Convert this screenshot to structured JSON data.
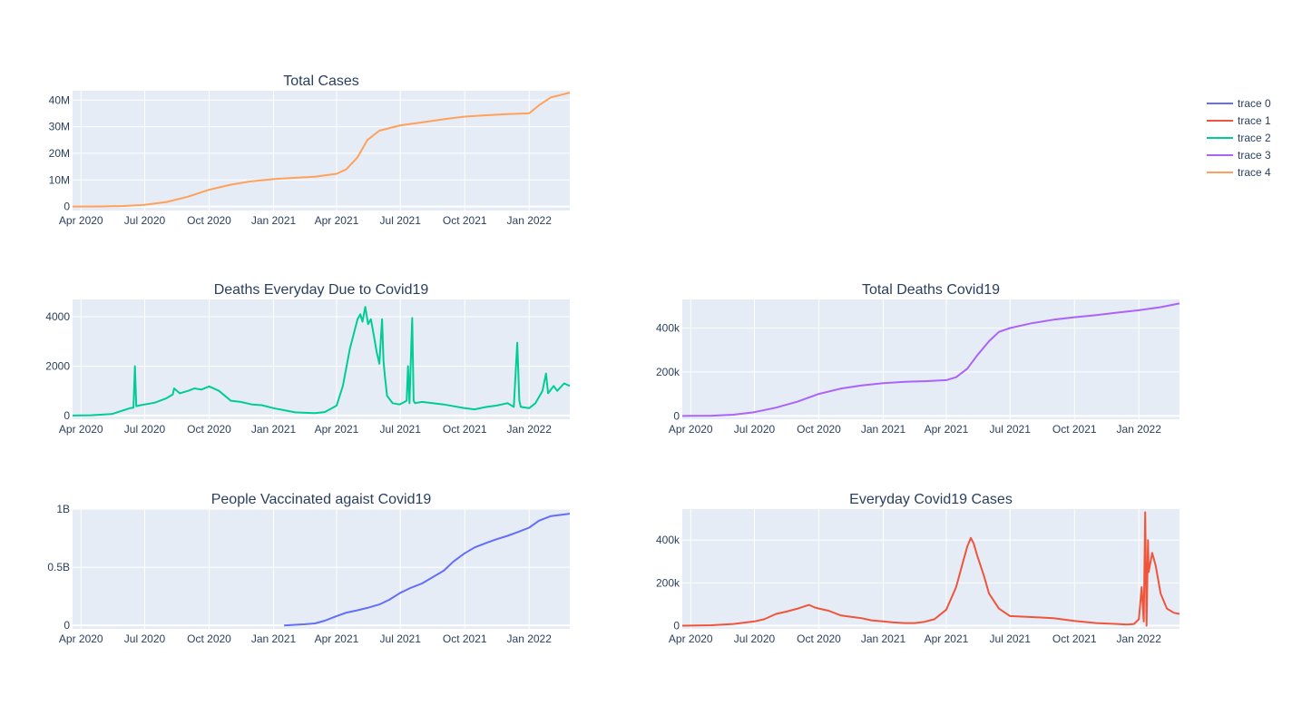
{
  "chart_data": [
    {
      "id": "total-cases",
      "type": "line",
      "title": "Total Cases",
      "trace": 4,
      "x_ticks": [
        "Apr 2020",
        "Jul 2020",
        "Oct 2020",
        "Jan 2021",
        "Apr 2021",
        "Jul 2021",
        "Oct 2021",
        "Jan 2022"
      ],
      "xlim": [
        "2020-03-20",
        "2022-02-28"
      ],
      "ylim": [
        -1500000,
        43500000
      ],
      "y_ticks": [
        {
          "v": 0,
          "label": "0"
        },
        {
          "v": 10000000,
          "label": "10M"
        },
        {
          "v": 20000000,
          "label": "20M"
        },
        {
          "v": 30000000,
          "label": "30M"
        },
        {
          "v": 40000000,
          "label": "40M"
        }
      ],
      "x": [
        "2020-03-20",
        "2020-05-01",
        "2020-06-01",
        "2020-07-01",
        "2020-08-01",
        "2020-09-01",
        "2020-10-01",
        "2020-11-01",
        "2020-12-01",
        "2021-01-01",
        "2021-02-01",
        "2021-03-01",
        "2021-04-01",
        "2021-04-15",
        "2021-05-01",
        "2021-05-15",
        "2021-06-01",
        "2021-07-01",
        "2021-08-01",
        "2021-09-01",
        "2021-10-01",
        "2021-11-01",
        "2021-12-01",
        "2022-01-01",
        "2022-01-15",
        "2022-02-01",
        "2022-02-28"
      ],
      "y": [
        0,
        35000,
        190000,
        600000,
        1700000,
        3700000,
        6300000,
        8200000,
        9500000,
        10300000,
        10800000,
        11200000,
        12300000,
        14000000,
        18500000,
        25000000,
        28500000,
        30500000,
        31600000,
        32800000,
        33800000,
        34300000,
        34700000,
        35000000,
        38000000,
        41000000,
        42800000
      ],
      "series": [
        {
          "name": "trace 4",
          "color": "#FFA15A"
        }
      ]
    },
    {
      "id": "deaths-everyday",
      "type": "line",
      "title": "Deaths Everyday Due to Covid19",
      "trace": 2,
      "x_ticks": [
        "Apr 2020",
        "Jul 2020",
        "Oct 2020",
        "Jan 2021",
        "Apr 2021",
        "Jul 2021",
        "Oct 2021",
        "Jan 2022"
      ],
      "xlim": [
        "2020-03-20",
        "2022-02-28"
      ],
      "ylim": [
        -150,
        4700
      ],
      "y_ticks": [
        {
          "v": 0,
          "label": "0"
        },
        {
          "v": 2000,
          "label": "2000"
        },
        {
          "v": 4000,
          "label": "4000"
        }
      ],
      "x": [
        "2020-03-20",
        "2020-04-15",
        "2020-05-15",
        "2020-06-10",
        "2020-06-15",
        "2020-06-17",
        "2020-06-19",
        "2020-06-25",
        "2020-07-15",
        "2020-08-01",
        "2020-08-10",
        "2020-08-12",
        "2020-08-20",
        "2020-09-01",
        "2020-09-10",
        "2020-09-20",
        "2020-10-01",
        "2020-10-15",
        "2020-11-01",
        "2020-11-15",
        "2020-12-01",
        "2020-12-15",
        "2021-01-01",
        "2021-01-15",
        "2021-02-01",
        "2021-02-15",
        "2021-03-01",
        "2021-03-15",
        "2021-04-01",
        "2021-04-10",
        "2021-04-20",
        "2021-05-01",
        "2021-05-05",
        "2021-05-08",
        "2021-05-12",
        "2021-05-16",
        "2021-05-20",
        "2021-05-25",
        "2021-05-28",
        "2021-06-01",
        "2021-06-05",
        "2021-06-07",
        "2021-06-09",
        "2021-06-12",
        "2021-06-20",
        "2021-06-30",
        "2021-07-10",
        "2021-07-12",
        "2021-07-14",
        "2021-07-18",
        "2021-07-20",
        "2021-07-22",
        "2021-08-01",
        "2021-09-01",
        "2021-10-01",
        "2021-10-15",
        "2021-11-01",
        "2021-11-15",
        "2021-12-01",
        "2021-12-10",
        "2021-12-15",
        "2021-12-18",
        "2021-12-20",
        "2022-01-01",
        "2022-01-10",
        "2022-01-20",
        "2022-01-25",
        "2022-01-28",
        "2022-02-05",
        "2022-02-10",
        "2022-02-20",
        "2022-02-28"
      ],
      "y": [
        0,
        10,
        60,
        300,
        320,
        2000,
        380,
        420,
        520,
        700,
        850,
        1100,
        900,
        1000,
        1100,
        1050,
        1180,
        1000,
        600,
        550,
        450,
        420,
        300,
        220,
        130,
        110,
        100,
        140,
        400,
        1200,
        2700,
        3900,
        4100,
        3800,
        4400,
        3700,
        3900,
        3100,
        2600,
        2100,
        3900,
        2200,
        1600,
        800,
        500,
        450,
        600,
        2000,
        500,
        3950,
        600,
        500,
        550,
        450,
        300,
        250,
        350,
        400,
        500,
        350,
        2950,
        600,
        350,
        300,
        500,
        1000,
        1700,
        900,
        1200,
        1000,
        1300,
        1200
      ],
      "series": [
        {
          "name": "trace 2",
          "color": "#00CC96"
        }
      ]
    },
    {
      "id": "total-deaths",
      "type": "line",
      "title": "Total Deaths Covid19",
      "trace": 3,
      "x_ticks": [
        "Apr 2020",
        "Jul 2020",
        "Oct 2020",
        "Jan 2021",
        "Apr 2021",
        "Jul 2021",
        "Oct 2021",
        "Jan 2022"
      ],
      "xlim": [
        "2020-03-20",
        "2022-02-28"
      ],
      "ylim": [
        -15000,
        530000
      ],
      "y_ticks": [
        {
          "v": 0,
          "label": "0"
        },
        {
          "v": 200000,
          "label": "200k"
        },
        {
          "v": 400000,
          "label": "400k"
        }
      ],
      "x": [
        "2020-03-20",
        "2020-05-01",
        "2020-06-01",
        "2020-07-01",
        "2020-08-01",
        "2020-09-01",
        "2020-10-01",
        "2020-11-01",
        "2020-12-01",
        "2021-01-01",
        "2021-02-01",
        "2021-03-01",
        "2021-04-01",
        "2021-04-15",
        "2021-05-01",
        "2021-05-15",
        "2021-06-01",
        "2021-06-15",
        "2021-07-01",
        "2021-08-01",
        "2021-09-01",
        "2021-10-01",
        "2021-11-01",
        "2021-12-01",
        "2022-01-01",
        "2022-02-01",
        "2022-02-28"
      ],
      "y": [
        0,
        1200,
        5500,
        17000,
        38000,
        66000,
        100000,
        124000,
        139000,
        149000,
        155000,
        158000,
        163000,
        176000,
        215000,
        275000,
        340000,
        382000,
        400000,
        422000,
        438000,
        449000,
        459000,
        470000,
        481000,
        495000,
        512000
      ],
      "series": [
        {
          "name": "trace 3",
          "color": "#AB63FA"
        }
      ]
    },
    {
      "id": "people-vaccinated",
      "type": "line",
      "title": "People Vaccinated agaist Covid19",
      "trace": 0,
      "x_ticks": [
        "Apr 2020",
        "Jul 2020",
        "Oct 2020",
        "Jan 2021",
        "Apr 2021",
        "Jul 2021",
        "Oct 2021",
        "Jan 2022"
      ],
      "xlim": [
        "2020-03-20",
        "2022-02-28"
      ],
      "ylim": [
        -30000000,
        1000000000
      ],
      "y_ticks": [
        {
          "v": 0,
          "label": "0"
        },
        {
          "v": 500000000,
          "label": "0.5B"
        },
        {
          "v": 1000000000,
          "label": "1B"
        }
      ],
      "x": [
        "2021-01-16",
        "2021-02-01",
        "2021-02-15",
        "2021-03-01",
        "2021-03-15",
        "2021-04-01",
        "2021-04-15",
        "2021-05-01",
        "2021-05-15",
        "2021-06-01",
        "2021-06-15",
        "2021-07-01",
        "2021-07-15",
        "2021-08-01",
        "2021-08-15",
        "2021-09-01",
        "2021-09-15",
        "2021-10-01",
        "2021-10-15",
        "2021-11-01",
        "2021-11-15",
        "2021-12-01",
        "2021-12-15",
        "2022-01-01",
        "2022-01-15",
        "2022-02-01",
        "2022-02-28"
      ],
      "y": [
        0,
        5000000,
        10000000,
        17000000,
        40000000,
        80000000,
        110000000,
        130000000,
        150000000,
        180000000,
        220000000,
        280000000,
        320000000,
        360000000,
        410000000,
        470000000,
        550000000,
        620000000,
        670000000,
        710000000,
        740000000,
        770000000,
        800000000,
        840000000,
        900000000,
        940000000,
        960000000
      ],
      "series": [
        {
          "name": "trace 0",
          "color": "#636EFA"
        }
      ]
    },
    {
      "id": "everyday-cases",
      "type": "line",
      "title": "Everyday Covid19 Cases",
      "trace": 1,
      "x_ticks": [
        "Apr 2020",
        "Jul 2020",
        "Oct 2020",
        "Jan 2021",
        "Apr 2021",
        "Jul 2021",
        "Oct 2021",
        "Jan 2022"
      ],
      "xlim": [
        "2020-03-20",
        "2022-02-28"
      ],
      "ylim": [
        -15000,
        545000
      ],
      "y_ticks": [
        {
          "v": 0,
          "label": "0"
        },
        {
          "v": 200000,
          "label": "200k"
        },
        {
          "v": 400000,
          "label": "400k"
        }
      ],
      "x": [
        "2020-03-20",
        "2020-05-01",
        "2020-06-01",
        "2020-07-01",
        "2020-07-15",
        "2020-08-01",
        "2020-08-15",
        "2020-09-01",
        "2020-09-10",
        "2020-09-17",
        "2020-09-25",
        "2020-10-01",
        "2020-10-15",
        "2020-11-01",
        "2020-11-15",
        "2020-12-01",
        "2020-12-15",
        "2021-01-01",
        "2021-01-15",
        "2021-02-01",
        "2021-02-15",
        "2021-03-01",
        "2021-03-15",
        "2021-04-01",
        "2021-04-15",
        "2021-04-25",
        "2021-05-01",
        "2021-05-06",
        "2021-05-10",
        "2021-05-15",
        "2021-05-25",
        "2021-06-01",
        "2021-06-15",
        "2021-07-01",
        "2021-08-01",
        "2021-09-01",
        "2021-10-01",
        "2021-11-01",
        "2021-12-01",
        "2021-12-15",
        "2021-12-25",
        "2022-01-01",
        "2022-01-05",
        "2022-01-08",
        "2022-01-10",
        "2022-01-12",
        "2022-01-14",
        "2022-01-15",
        "2022-01-20",
        "2022-01-25",
        "2022-02-01",
        "2022-02-10",
        "2022-02-20",
        "2022-02-28"
      ],
      "y": [
        0,
        2000,
        8000,
        20000,
        30000,
        55000,
        65000,
        80000,
        90000,
        97000,
        85000,
        80000,
        70000,
        48000,
        42000,
        35000,
        25000,
        20000,
        15000,
        12000,
        12000,
        18000,
        30000,
        75000,
        180000,
        300000,
        370000,
        410000,
        385000,
        330000,
        230000,
        150000,
        80000,
        45000,
        40000,
        35000,
        22000,
        12000,
        8000,
        5000,
        8000,
        30000,
        180000,
        20000,
        530000,
        0,
        400000,
        250000,
        340000,
        280000,
        150000,
        80000,
        60000,
        55000
      ],
      "series": [
        {
          "name": "trace 1",
          "color": "#EF553B"
        }
      ]
    }
  ],
  "legend": {
    "placement": "top-right",
    "items": [
      {
        "name": "trace 0",
        "color": "#636EFA"
      },
      {
        "name": "trace 1",
        "color": "#EF553B"
      },
      {
        "name": "trace 2",
        "color": "#00CC96"
      },
      {
        "name": "trace 3",
        "color": "#AB63FA"
      },
      {
        "name": "trace 4",
        "color": "#FFA15A"
      }
    ]
  },
  "style": {
    "plot_bg": "#E5ECF6",
    "grid": "#ffffff",
    "text": "#2a3f5f",
    "grid_on": true
  }
}
